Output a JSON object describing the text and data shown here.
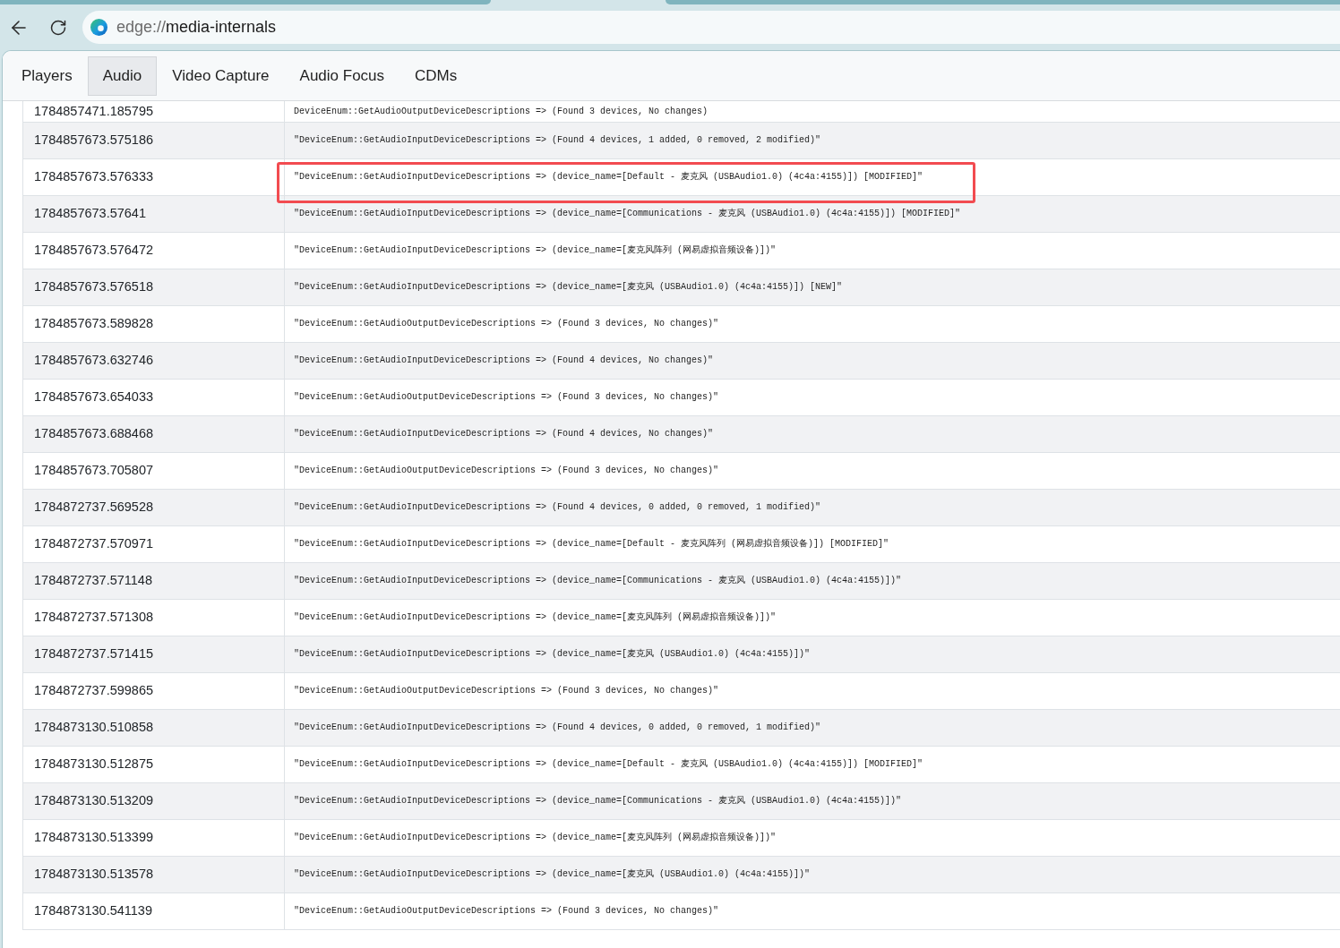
{
  "toolbar": {
    "address": {
      "scheme": "edge://",
      "path": "media-internals"
    }
  },
  "tabs": [
    {
      "label": "Players",
      "selected": false
    },
    {
      "label": "Audio",
      "selected": true
    },
    {
      "label": "Video Capture",
      "selected": false
    },
    {
      "label": "Audio Focus",
      "selected": false
    },
    {
      "label": "CDMs",
      "selected": false
    }
  ],
  "log": {
    "rows": [
      {
        "timestamp": "1784857471.185795",
        "message": "DeviceEnum::GetAudioOutputDeviceDescriptions => (Found 3 devices, No changes)",
        "highlighted": false
      },
      {
        "timestamp": "1784857673.575186",
        "message": "\"DeviceEnum::GetAudioInputDeviceDescriptions => (Found 4 devices, 1 added, 0 removed, 2 modified)\"",
        "highlighted": false
      },
      {
        "timestamp": "1784857673.576333",
        "message": "\"DeviceEnum::GetAudioInputDeviceDescriptions => (device_name=[Default - 麦克风 (USBAudio1.0) (4c4a:4155)]) [MODIFIED]\"",
        "highlighted": true
      },
      {
        "timestamp": "1784857673.57641",
        "message": "\"DeviceEnum::GetAudioInputDeviceDescriptions => (device_name=[Communications - 麦克风 (USBAudio1.0) (4c4a:4155)]) [MODIFIED]\"",
        "highlighted": false
      },
      {
        "timestamp": "1784857673.576472",
        "message": "\"DeviceEnum::GetAudioInputDeviceDescriptions => (device_name=[麦克风阵列 (网易虚拟音频设备)])\"",
        "highlighted": false
      },
      {
        "timestamp": "1784857673.576518",
        "message": "\"DeviceEnum::GetAudioInputDeviceDescriptions => (device_name=[麦克风 (USBAudio1.0) (4c4a:4155)]) [NEW]\"",
        "highlighted": false
      },
      {
        "timestamp": "1784857673.589828",
        "message": "\"DeviceEnum::GetAudioOutputDeviceDescriptions => (Found 3 devices, No changes)\"",
        "highlighted": false
      },
      {
        "timestamp": "1784857673.632746",
        "message": "\"DeviceEnum::GetAudioInputDeviceDescriptions => (Found 4 devices, No changes)\"",
        "highlighted": false
      },
      {
        "timestamp": "1784857673.654033",
        "message": "\"DeviceEnum::GetAudioOutputDeviceDescriptions => (Found 3 devices, No changes)\"",
        "highlighted": false
      },
      {
        "timestamp": "1784857673.688468",
        "message": "\"DeviceEnum::GetAudioInputDeviceDescriptions => (Found 4 devices, No changes)\"",
        "highlighted": false
      },
      {
        "timestamp": "1784857673.705807",
        "message": "\"DeviceEnum::GetAudioOutputDeviceDescriptions => (Found 3 devices, No changes)\"",
        "highlighted": false
      },
      {
        "timestamp": "1784872737.569528",
        "message": "\"DeviceEnum::GetAudioInputDeviceDescriptions => (Found 4 devices, 0 added, 0 removed, 1 modified)\"",
        "highlighted": false
      },
      {
        "timestamp": "1784872737.570971",
        "message": "\"DeviceEnum::GetAudioInputDeviceDescriptions => (device_name=[Default - 麦克风阵列 (网易虚拟音频设备)]) [MODIFIED]\"",
        "highlighted": false
      },
      {
        "timestamp": "1784872737.571148",
        "message": "\"DeviceEnum::GetAudioInputDeviceDescriptions => (device_name=[Communications - 麦克风 (USBAudio1.0) (4c4a:4155)])\"",
        "highlighted": false
      },
      {
        "timestamp": "1784872737.571308",
        "message": "\"DeviceEnum::GetAudioInputDeviceDescriptions => (device_name=[麦克风阵列 (网易虚拟音频设备)])\"",
        "highlighted": false
      },
      {
        "timestamp": "1784872737.571415",
        "message": "\"DeviceEnum::GetAudioInputDeviceDescriptions => (device_name=[麦克风 (USBAudio1.0) (4c4a:4155)])\"",
        "highlighted": false
      },
      {
        "timestamp": "1784872737.599865",
        "message": "\"DeviceEnum::GetAudioOutputDeviceDescriptions => (Found 3 devices, No changes)\"",
        "highlighted": false
      },
      {
        "timestamp": "1784873130.510858",
        "message": "\"DeviceEnum::GetAudioInputDeviceDescriptions => (Found 4 devices, 0 added, 0 removed, 1 modified)\"",
        "highlighted": false
      },
      {
        "timestamp": "1784873130.512875",
        "message": "\"DeviceEnum::GetAudioInputDeviceDescriptions => (device_name=[Default - 麦克风 (USBAudio1.0) (4c4a:4155)]) [MODIFIED]\"",
        "highlighted": false
      },
      {
        "timestamp": "1784873130.513209",
        "message": "\"DeviceEnum::GetAudioInputDeviceDescriptions => (device_name=[Communications - 麦克风 (USBAudio1.0) (4c4a:4155)])\"",
        "highlighted": false
      },
      {
        "timestamp": "1784873130.513399",
        "message": "\"DeviceEnum::GetAudioInputDeviceDescriptions => (device_name=[麦克风阵列 (网易虚拟音频设备)])\"",
        "highlighted": false
      },
      {
        "timestamp": "1784873130.513578",
        "message": "\"DeviceEnum::GetAudioInputDeviceDescriptions => (device_name=[麦克风 (USBAudio1.0) (4c4a:4155)])\"",
        "highlighted": false
      },
      {
        "timestamp": "1784873130.541139",
        "message": "\"DeviceEnum::GetAudioOutputDeviceDescriptions => (Found 3 devices, No changes)\"",
        "highlighted": false
      }
    ]
  }
}
